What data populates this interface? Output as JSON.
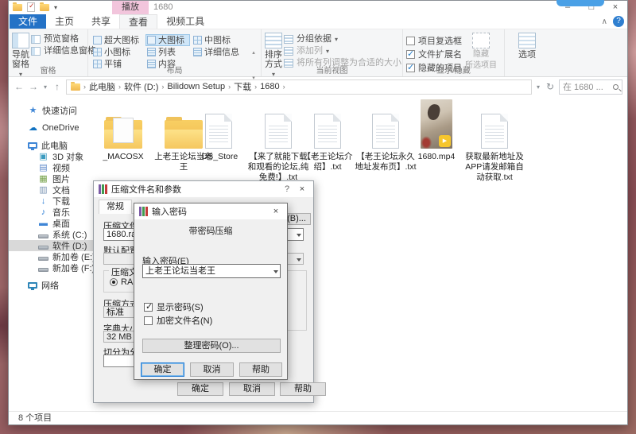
{
  "glyphs": {
    "min": "–",
    "max": "□",
    "close": "×",
    "back": "←",
    "fwd": "→",
    "up": "↑",
    "refresh": "↻",
    "dropdown": "▾",
    "collapse": "∧",
    "help": "?",
    "scroll_up": "▴",
    "scroll_down": "▾",
    "play": "▶"
  },
  "window": {
    "title": "1680"
  },
  "tabs": {
    "file": "文件",
    "home": "主页",
    "share": "共享",
    "view": "查看",
    "video_tools": "视频工具",
    "contextual": "播放"
  },
  "ribbon": {
    "panes": {
      "nav": "导航窗格",
      "preview": "预览窗格",
      "details": "详细信息窗格",
      "label": "窗格"
    },
    "layout": {
      "items": [
        "超大图标",
        "大图标",
        "中图标",
        "小图标",
        "列表",
        "详细信息",
        "平铺",
        "内容"
      ],
      "label": "布局"
    },
    "view": {
      "sort": "排序方式",
      "group_by": "分组依据",
      "add_col": "添加列",
      "fit": "将所有列调整为合适的大小",
      "label": "当前视图"
    },
    "show": {
      "item_checkboxes": "项目复选框",
      "file_ext": "文件扩展名",
      "hidden_items": "隐藏的项目",
      "hide_sel_1": "隐藏",
      "hide_sel_2": "所选项目",
      "label": "显示/隐藏"
    },
    "options": {
      "label": "选项"
    }
  },
  "address": {
    "crumbs": [
      "此电脑",
      "软件 (D:)",
      "Bilidown Setup",
      "下载",
      "1680"
    ],
    "search_placeholder": "在 1680 ..."
  },
  "sidebar": {
    "items": [
      {
        "label": "快速访问"
      },
      {
        "label": "OneDrive"
      },
      {
        "label": "此电脑"
      },
      {
        "label": "3D 对象"
      },
      {
        "label": "视频"
      },
      {
        "label": "图片"
      },
      {
        "label": "文档"
      },
      {
        "label": "下载"
      },
      {
        "label": "音乐"
      },
      {
        "label": "桌面"
      },
      {
        "label": "系统 (C:)"
      },
      {
        "label": "软件 (D:)"
      },
      {
        "label": "新加卷 (E:)"
      },
      {
        "label": "新加卷 (F:)"
      },
      {
        "label": "网络"
      }
    ]
  },
  "files": [
    {
      "name": "_MACOSX",
      "type": "folder-with-contents"
    },
    {
      "name": "上老王论坛当老王",
      "type": "folder"
    },
    {
      "name": ".DS_Store",
      "type": "document"
    },
    {
      "name": "【来了就能下载和观看的论坛,纯免费!】.txt",
      "type": "document"
    },
    {
      "name": "【老王论坛介绍】.txt",
      "type": "document"
    },
    {
      "name": "【老王论坛永久地址发布页】.txt",
      "type": "document"
    },
    {
      "name": "1680.mp4",
      "type": "video"
    },
    {
      "name": "获取最新地址及APP请发邮箱自动获取.txt",
      "type": "document"
    }
  ],
  "outer_dialog": {
    "title": "压缩文件名和参数",
    "tab_general": "常规",
    "archive_label": "压缩文件名(A)",
    "archive_value": "1680.rar",
    "profile_label": "默认配置",
    "browse": "浏览(B)...",
    "format_legend": "压缩文件格式",
    "format_rar": "RAR",
    "method_label": "压缩方式",
    "method_value": "标准",
    "dict_label": "字典大小",
    "dict_value": "32 MB",
    "split_label": "切分为分卷，大小(V)",
    "split_value": "",
    "ok": "确定",
    "cancel": "取消",
    "help": "帮助"
  },
  "inner_dialog": {
    "title": "输入密码",
    "heading": "带密码压缩",
    "password_label": "输入密码(E)",
    "password_value": "上老王论坛当老王",
    "show_password": "显示密码(S)",
    "encrypt_names": "加密文件名(N)",
    "organize": "整理密码(O)...",
    "ok": "确定",
    "cancel": "取消",
    "help": "帮助"
  },
  "statusbar": {
    "count": "8 个项目"
  }
}
